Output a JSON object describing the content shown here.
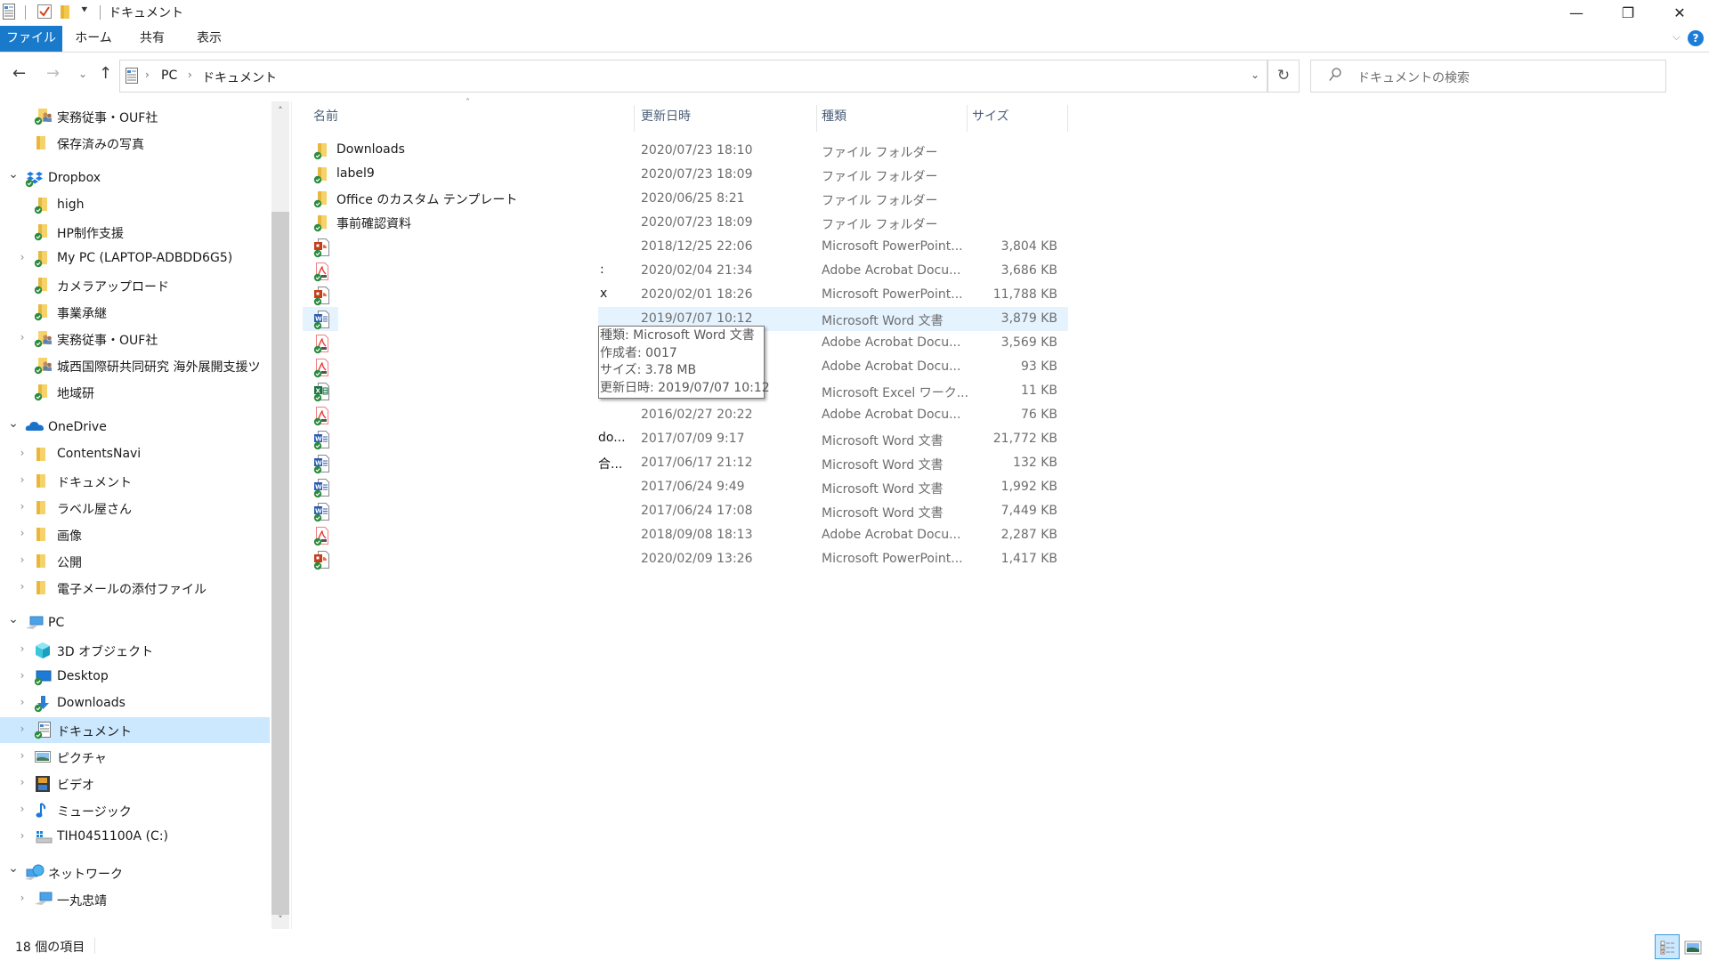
{
  "window": {
    "title": "ドキュメント",
    "quick_access_icons": [
      "properties-icon",
      "checkmark-icon",
      "new-folder-icon",
      "customize-dropdown-icon"
    ],
    "controls": {
      "minimize": "—",
      "maximize": "❐",
      "close": "✕"
    }
  },
  "ribbon": {
    "tabs": [
      {
        "label": "ファイル",
        "active": true
      },
      {
        "label": "ホーム"
      },
      {
        "label": "共有"
      },
      {
        "label": "表示"
      }
    ],
    "help_label": "?",
    "expand_glyph": "⌵"
  },
  "nav": {
    "back": "←",
    "forward": "→",
    "recent": "⌄",
    "up": "↑",
    "breadcrumb": [
      "PC",
      "ドキュメント"
    ],
    "crumb_sep": "›",
    "dropdown": "⌄",
    "refresh": "↻",
    "search_placeholder": "ドキュメントの検索",
    "search_glyph": "⌕"
  },
  "sidebar": {
    "items": [
      {
        "label": "実務従事・OUF社",
        "icon": "shared-folder-icon",
        "chevron": "",
        "indent": 2
      },
      {
        "label": "保存済みの写真",
        "icon": "folder-icon",
        "chevron": "",
        "indent": 2
      },
      {
        "label": "Dropbox",
        "icon": "dropbox-icon",
        "chevron": "open",
        "indent": 1,
        "gap": true
      },
      {
        "label": "high",
        "icon": "folder-synced-icon",
        "chevron": "",
        "indent": 2
      },
      {
        "label": "HP制作支援",
        "icon": "folder-synced-icon",
        "chevron": "",
        "indent": 2
      },
      {
        "label": "My PC (LAPTOP-ADBDD6G5)",
        "icon": "folder-synced-icon",
        "chevron": "closed",
        "indent": 2
      },
      {
        "label": "カメラアップロード",
        "icon": "folder-synced-icon",
        "chevron": "",
        "indent": 2
      },
      {
        "label": "事業承継",
        "icon": "folder-synced-icon",
        "chevron": "",
        "indent": 2
      },
      {
        "label": "実務従事・OUF社",
        "icon": "shared-folder-icon",
        "chevron": "closed",
        "indent": 2
      },
      {
        "label": "城西国際研共同研究 海外展開支援ツ",
        "icon": "shared-folder-icon",
        "chevron": "",
        "indent": 2
      },
      {
        "label": "地域研",
        "icon": "folder-synced-icon",
        "chevron": "",
        "indent": 2
      },
      {
        "label": "OneDrive",
        "icon": "onedrive-icon",
        "chevron": "open",
        "indent": 1,
        "gap": true
      },
      {
        "label": "ContentsNavi",
        "icon": "folder-icon",
        "chevron": "closed",
        "indent": 2
      },
      {
        "label": "ドキュメント",
        "icon": "folder-icon",
        "chevron": "closed",
        "indent": 2
      },
      {
        "label": "ラベル屋さん",
        "icon": "folder-icon",
        "chevron": "closed",
        "indent": 2
      },
      {
        "label": "画像",
        "icon": "folder-icon",
        "chevron": "closed",
        "indent": 2
      },
      {
        "label": "公開",
        "icon": "folder-icon",
        "chevron": "closed",
        "indent": 2
      },
      {
        "label": "電子メールの添付ファイル",
        "icon": "folder-icon",
        "chevron": "closed",
        "indent": 2
      },
      {
        "label": "PC",
        "icon": "pc-icon",
        "chevron": "open",
        "indent": 1,
        "gap": true
      },
      {
        "label": "3D オブジェクト",
        "icon": "3d-objects-icon",
        "chevron": "closed",
        "indent": 2
      },
      {
        "label": "Desktop",
        "icon": "desktop-icon",
        "chevron": "closed",
        "indent": 2
      },
      {
        "label": "Downloads",
        "icon": "downloads-icon",
        "chevron": "closed",
        "indent": 2
      },
      {
        "label": "ドキュメント",
        "icon": "documents-icon",
        "chevron": "closed",
        "indent": 2,
        "selected": true
      },
      {
        "label": "ピクチャ",
        "icon": "pictures-icon",
        "chevron": "closed",
        "indent": 2
      },
      {
        "label": "ビデオ",
        "icon": "videos-icon",
        "chevron": "closed",
        "indent": 2
      },
      {
        "label": "ミュージック",
        "icon": "music-icon",
        "chevron": "closed",
        "indent": 2
      },
      {
        "label": "TIH0451100A (C:)",
        "icon": "drive-icon",
        "chevron": "closed",
        "indent": 2
      },
      {
        "label": "ネットワーク",
        "icon": "network-icon",
        "chevron": "open",
        "indent": 1,
        "gap": true
      },
      {
        "label": "一丸忠靖",
        "icon": "network-computer-icon",
        "chevron": "closed",
        "indent": 2
      }
    ],
    "scroll_up": "˄",
    "scroll_down": "˅"
  },
  "file_list": {
    "columns": [
      "名前",
      "更新日時",
      "種類",
      "サイズ"
    ],
    "sort_glyph": "˄",
    "rows": [
      {
        "name": "Downloads",
        "date": "2020/07/23 18:10",
        "type": "ファイル フォルダー",
        "size": "",
        "icon": "folder-icon"
      },
      {
        "name": "label9",
        "date": "2020/07/23 18:09",
        "type": "ファイル フォルダー",
        "size": "",
        "icon": "folder-icon"
      },
      {
        "name": "Office のカスタム テンプレート",
        "date": "2020/06/25 8:21",
        "type": "ファイル フォルダー",
        "size": "",
        "icon": "folder-icon"
      },
      {
        "name": "事前確認資料",
        "date": "2020/07/23 18:09",
        "type": "ファイル フォルダー",
        "size": "",
        "icon": "folder-icon"
      },
      {
        "name": "",
        "date": "2018/12/25 22:06",
        "type": "Microsoft PowerPoint...",
        "size": "3,804 KB",
        "icon": "powerpoint-icon"
      },
      {
        "name": "",
        "date": "2020/02/04 21:34",
        "type": "Adobe Acrobat Docu...",
        "size": "3,686 KB",
        "icon": "pdf-icon",
        "frag": ":"
      },
      {
        "name": "",
        "date": "2020/02/01 18:26",
        "type": "Microsoft PowerPoint...",
        "size": "11,788 KB",
        "icon": "powerpoint-icon",
        "frag": "x"
      },
      {
        "name": "",
        "date": "2019/07/07 10:12",
        "type": "Microsoft Word 文書",
        "size": "3,879 KB",
        "icon": "word-icon",
        "hover": true
      },
      {
        "name": "",
        "date": "",
        "type": "Adobe Acrobat Docu...",
        "size": "3,569 KB",
        "icon": "pdf-icon"
      },
      {
        "name": "",
        "date": "",
        "type": "Adobe Acrobat Docu...",
        "size": "93 KB",
        "icon": "pdf-icon"
      },
      {
        "name": "",
        "date": "",
        "type": "Microsoft Excel ワーク...",
        "size": "11 KB",
        "icon": "excel-icon"
      },
      {
        "name": "",
        "date": "2016/02/27 20:22",
        "type": "Adobe Acrobat Docu...",
        "size": "76 KB",
        "icon": "pdf-icon"
      },
      {
        "name": "",
        "date": "2017/07/09 9:17",
        "type": "Microsoft Word 文書",
        "size": "21,772 KB",
        "icon": "word-icon",
        "frag": "do..."
      },
      {
        "name": "",
        "date": "2017/06/17 21:12",
        "type": "Microsoft Word 文書",
        "size": "132 KB",
        "icon": "word-icon",
        "frag": "合..."
      },
      {
        "name": "",
        "date": "2017/06/24 9:49",
        "type": "Microsoft Word 文書",
        "size": "1,992 KB",
        "icon": "word-icon"
      },
      {
        "name": "",
        "date": "2017/06/24 17:08",
        "type": "Microsoft Word 文書",
        "size": "7,449 KB",
        "icon": "word-icon"
      },
      {
        "name": "",
        "date": "2018/09/08 18:13",
        "type": "Adobe Acrobat Docu...",
        "size": "2,287 KB",
        "icon": "pdf-icon"
      },
      {
        "name": "",
        "date": "2020/02/09 13:26",
        "type": "Microsoft PowerPoint...",
        "size": "1,417 KB",
        "icon": "powerpoint-icon"
      }
    ]
  },
  "tooltip": {
    "lines": [
      "種類: Microsoft Word 文書",
      "作成者: 0017",
      "サイズ: 3.78 MB",
      "更新日時: 2019/07/07 10:12"
    ]
  },
  "status_bar": {
    "item_count": "18 個の項目",
    "views": [
      "details-view-icon",
      "large-icons-view-icon"
    ]
  },
  "colors": {
    "accent": "#1979ca",
    "selection": "#cce8ff",
    "hover": "#e5f3ff",
    "folder": "#f3c94b",
    "sync_ok": "#2b8a3e"
  }
}
